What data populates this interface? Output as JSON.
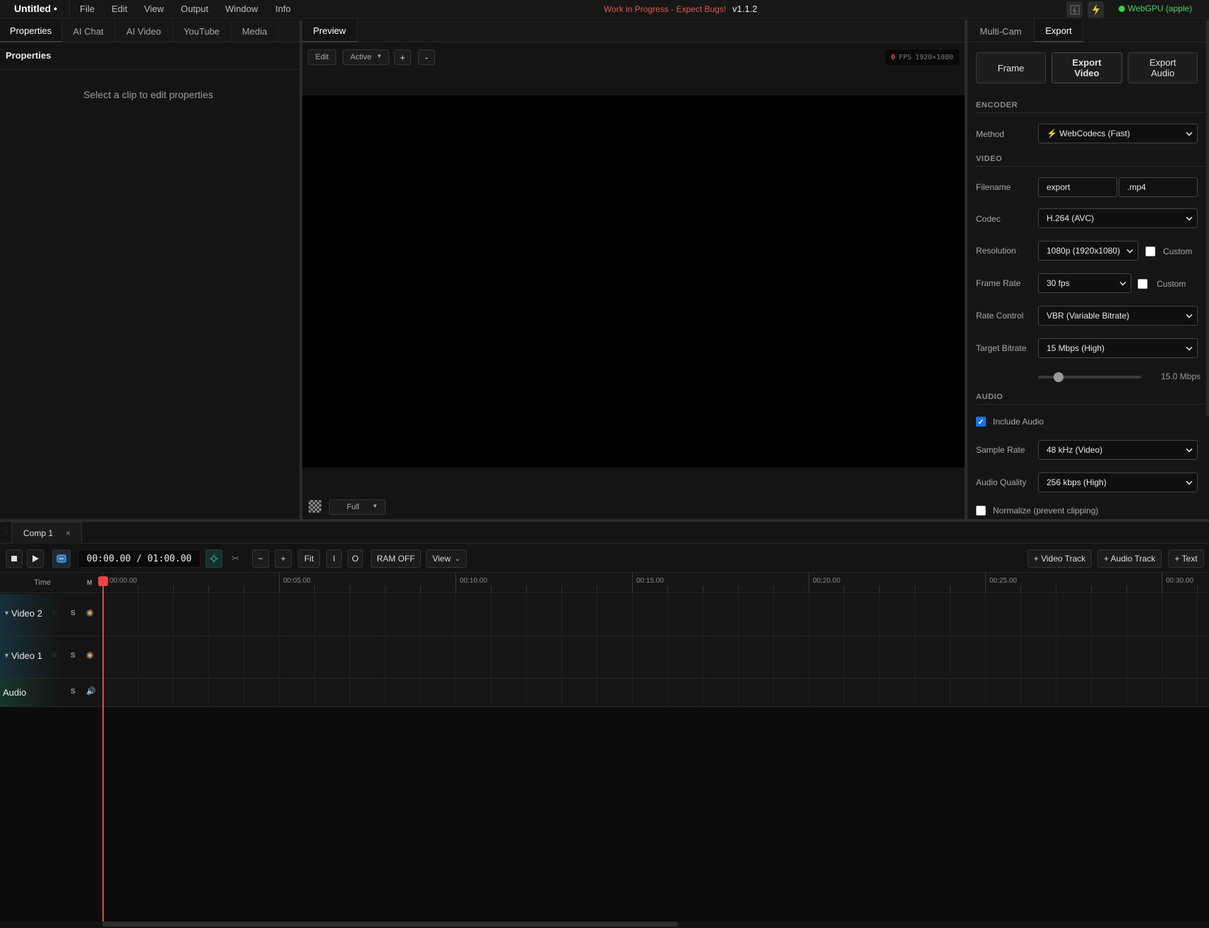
{
  "app": {
    "title": "Untitled •",
    "menu": [
      "File",
      "Edit",
      "View",
      "Output",
      "Window",
      "Info"
    ],
    "wip_notice": "Work in Progress - Expect Bugs!",
    "version": "v1.1.2",
    "gpu_status": "WebGPU (apple)",
    "gpu_status_color": "#35d04a"
  },
  "left_panel": {
    "tabs": [
      "Properties",
      "AI Chat",
      "AI Video",
      "YouTube",
      "Media"
    ],
    "active_tab": "Properties",
    "header": "Properties",
    "empty_message": "Select a clip to edit properties"
  },
  "preview": {
    "tab": "Preview",
    "edit_label": "Edit",
    "mode_label": "Active",
    "zoom_in": "+",
    "zoom_out": "-",
    "fps_value": "0",
    "fps_unit": "FPS",
    "resolution": "1920×1080",
    "quality_label": "Full"
  },
  "right_panel": {
    "tabs": [
      "Multi-Cam",
      "Export"
    ],
    "active_tab": "Export",
    "buttons": {
      "frame": "Frame",
      "export_video_1": "Export",
      "export_video_2": "Video",
      "export_audio_1": "Export",
      "export_audio_2": "Audio"
    },
    "encoder": {
      "section": "ENCODER",
      "method_label": "Method",
      "method_value": "⚡ WebCodecs (Fast)"
    },
    "video": {
      "section": "VIDEO",
      "filename_label": "Filename",
      "filename_value": "export",
      "extension": ".mp4",
      "codec_label": "Codec",
      "codec_value": "H.264 (AVC)",
      "resolution_label": "Resolution",
      "resolution_value": "1080p (1920x1080)",
      "resolution_custom": "Custom",
      "framerate_label": "Frame Rate",
      "framerate_value": "30 fps",
      "framerate_custom": "Custom",
      "ratecontrol_label": "Rate Control",
      "ratecontrol_value": "VBR (Variable Bitrate)",
      "bitrate_label": "Target Bitrate",
      "bitrate_value": "15 Mbps (High)",
      "bitrate_slider_text": "15.0 Mbps",
      "bitrate_slider_fraction": 0.13
    },
    "audio": {
      "section": "AUDIO",
      "include_label": "Include Audio",
      "include_checked": true,
      "samplerate_label": "Sample Rate",
      "samplerate_value": "48 kHz (Video)",
      "quality_label": "Audio Quality",
      "quality_value": "256 kbps (High)",
      "normalize_label": "Normalize (prevent clipping)",
      "normalize_checked": false
    }
  },
  "timeline": {
    "comp_tab": "Comp 1",
    "close": "×",
    "timecode": "00:00.00 / 01:00.00",
    "buttons": {
      "minus": "−",
      "plus": "+",
      "fit": "Fit",
      "in": "I",
      "out": "O",
      "ram": "RAM OFF",
      "view": "View",
      "add_video": "+ Video Track",
      "add_audio": "+ Audio Track",
      "add_text": "+ Text"
    },
    "header": {
      "time": "Time",
      "m": "M"
    },
    "ruler_labels": [
      "00:00.00",
      "00:05.00",
      "00:10.00",
      "00:15.00",
      "00:20.00",
      "00:25.00",
      "00:30.00"
    ],
    "tracks": [
      {
        "name": "Video 2",
        "solo": "S"
      },
      {
        "name": "Video 1",
        "solo": "S"
      },
      {
        "name": "Audio",
        "solo": "S"
      }
    ]
  }
}
